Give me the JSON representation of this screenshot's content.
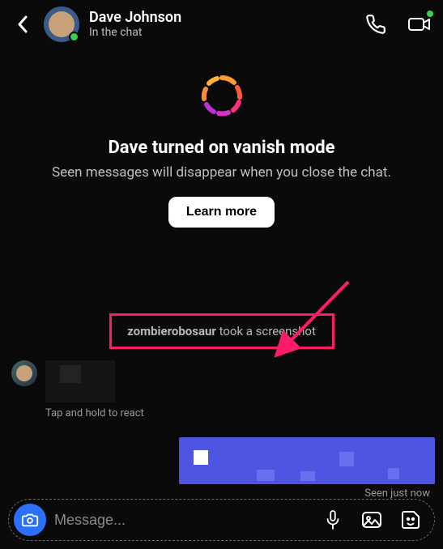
{
  "header": {
    "name": "Dave Johnson",
    "status": "In the chat"
  },
  "vanish": {
    "title": "Dave turned on vanish mode",
    "subtitle": "Seen messages will disappear when you close the chat.",
    "learn_more": "Learn more"
  },
  "screenshot_notice": {
    "username": "zombierobosaur",
    "suffix": " took a screenshot"
  },
  "react_hint": "Tap and hold to react",
  "seen_label": "Seen just now",
  "composer": {
    "placeholder": "Message..."
  },
  "icons": {
    "back": "back-chevron",
    "call": "phone",
    "video": "video",
    "camera": "camera",
    "mic": "microphone",
    "gallery": "image",
    "sticker": "sticker-smile"
  },
  "colors": {
    "highlight_border": "#ff1b6b",
    "presence": "#3ccf4e",
    "composer_cam": "#2b6fff",
    "message_bubble": "#4f55e3"
  }
}
